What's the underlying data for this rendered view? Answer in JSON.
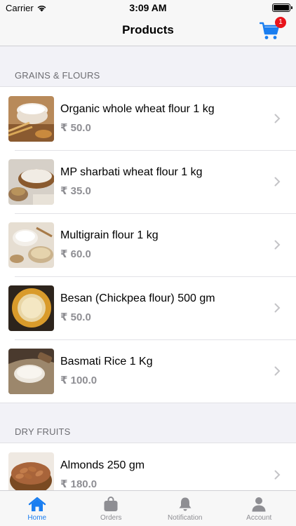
{
  "status_bar": {
    "carrier": "Carrier",
    "time": "3:09 AM"
  },
  "nav": {
    "title": "Products",
    "cart_count": "1"
  },
  "sections": [
    {
      "title": "GRAINS & FLOURS",
      "items": [
        {
          "name": "Organic whole wheat flour 1 kg",
          "price": "₹ 50.0",
          "image": "wheat-flour-bowl"
        },
        {
          "name": "MP sharbati wheat flour 1 kg",
          "price": "₹ 35.0",
          "image": "flour-bowl-sack"
        },
        {
          "name": "Multigrain flour 1 kg",
          "price": "₹ 60.0",
          "image": "multigrain-flour"
        },
        {
          "name": "Besan (Chickpea flour) 500 gm",
          "price": "₹ 50.0",
          "image": "besan-bowl"
        },
        {
          "name": "Basmati Rice 1 Kg",
          "price": "₹ 100.0",
          "image": "rice-sack"
        }
      ]
    },
    {
      "title": "DRY FRUITS",
      "items": [
        {
          "name": "Almonds 250 gm",
          "price": "₹ 180.0",
          "image": "almonds-bowl"
        }
      ]
    }
  ],
  "tabs": [
    {
      "label": "Home",
      "icon": "home-icon",
      "active": true
    },
    {
      "label": "Orders",
      "icon": "bag-icon",
      "active": false
    },
    {
      "label": "Notification",
      "icon": "bell-icon",
      "active": false
    },
    {
      "label": "Account",
      "icon": "person-icon",
      "active": false
    }
  ],
  "colors": {
    "accent": "#1a7ef0",
    "badge": "#e8141b",
    "muted": "#8e8e93"
  }
}
